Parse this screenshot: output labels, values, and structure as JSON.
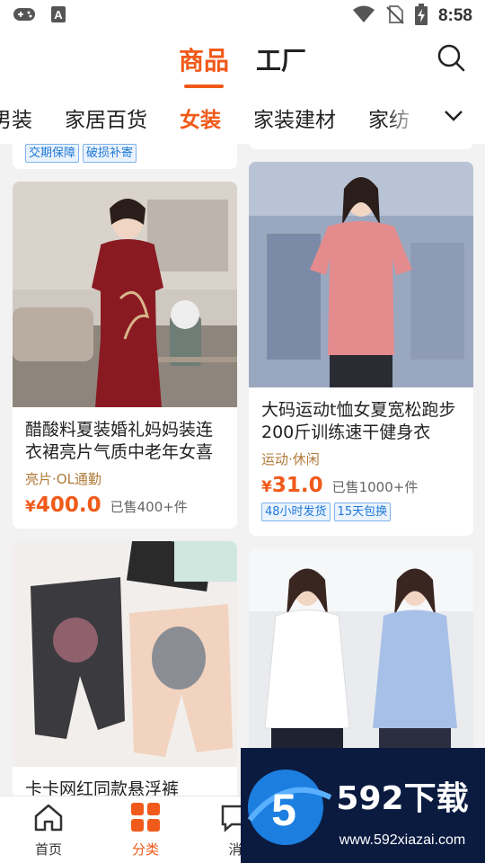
{
  "status_bar": {
    "time": "8:58",
    "left_icons": [
      "gamepad-icon",
      "keyboard-a-icon"
    ],
    "right_icons": [
      "wifi-icon",
      "no-sim-icon",
      "battery-charging-icon"
    ]
  },
  "header": {
    "tabs": [
      {
        "label": "商品",
        "active": true
      },
      {
        "label": "工厂",
        "active": false
      }
    ],
    "search_icon": "search-icon"
  },
  "categories": {
    "items": [
      {
        "label": "男装",
        "active": false
      },
      {
        "label": "家居百货",
        "active": false
      },
      {
        "label": "女装",
        "active": true
      },
      {
        "label": "家装建材",
        "active": false
      },
      {
        "label": "家纺",
        "active": false
      }
    ],
    "more_icon": "chevron-down-icon"
  },
  "products": [
    {
      "title": "",
      "tags": [
        "交期保障",
        "破损补寄"
      ]
    },
    {
      "title": "醋酸料夏装婚礼妈妈装连衣裙亮片气质中老年女喜",
      "style": "亮片·OL通勤",
      "currency": "¥",
      "price": "400.0",
      "sold": "已售400+件",
      "tags": []
    },
    {
      "title": "大码运动t恤女夏宽松跑步200斤训练速干健身衣",
      "style": "运动·休闲",
      "currency": "¥",
      "price": "31.0",
      "sold": "已售1000+件",
      "tags": [
        "48小时发货",
        "15天包换"
      ]
    },
    {
      "title": "卡卡网红同款悬浮裤",
      "style": "",
      "tags": []
    },
    {
      "title": "",
      "tags": []
    }
  ],
  "bottom_nav": [
    {
      "label": "首页",
      "icon": "home-icon",
      "active": false
    },
    {
      "label": "分类",
      "icon": "category-grid-icon",
      "active": true
    },
    {
      "label": "消",
      "icon": "message-icon",
      "active": false
    }
  ],
  "watermark": {
    "brand": "592下载",
    "url": "www.592xiazai.com",
    "logo_digit": "5"
  },
  "colors": {
    "accent": "#f05a1a",
    "tag_blue": "#1e78d6",
    "style_text": "#b07a3a"
  }
}
